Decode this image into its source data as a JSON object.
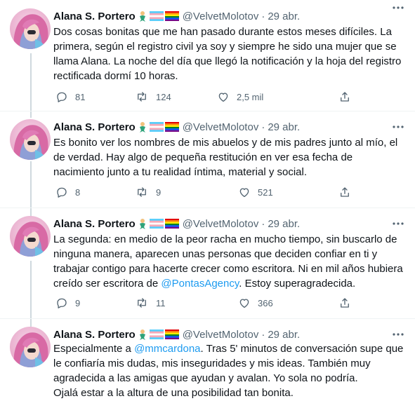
{
  "author": {
    "name": "Alana S. Portero",
    "handle": "@VelvetMolotov",
    "separator": "·",
    "date": "29 abr.",
    "emojis": [
      "mermaid-emoji",
      "trans-flag-emoji",
      "rainbow-flag-emoji"
    ]
  },
  "tweets": [
    {
      "text": "Dos cosas bonitas que me han pasado durante estos meses difíciles. La primera, según el registro civil ya soy y siempre he sido una mujer que se llama Alana. La noche del día que llegó la notificación y la hoja del registro rectificada dormí 10 horas.",
      "replies": "81",
      "retweets": "124",
      "likes": "2,5 mil"
    },
    {
      "text": "Es bonito ver los nombres de mis abuelos y de mis padres junto al mío, el de verdad. Hay algo de pequeña restitución en ver esa fecha de nacimiento junto a tu realidad íntima, material y social.",
      "replies": "8",
      "retweets": "9",
      "likes": "521"
    },
    {
      "text_before": "La segunda: en medio de la peor racha en mucho tiempo, sin buscarlo de ninguna manera, aparecen unas personas que deciden confiar en ti y trabajar contigo para hacerte crecer como escritora. Ni en mil años hubiera creído ser escritora de ",
      "mention": "@PontasAgency",
      "text_after": ". Estoy superagradecida.",
      "replies": "9",
      "retweets": "11",
      "likes": "366"
    },
    {
      "text_before": "Especialmente a ",
      "mention": "@mmcardona",
      "text_after": ". Tras 5' minutos de conversación supe que le confiaría mis dudas, mis inseguridades y mis ideas. También muy agradecida a las amigas que ayudan y avalan. Yo sola no podría.\nOjalá estar a la altura de una posibilidad tan bonita."
    }
  ],
  "colors": {
    "text": "#0f1419",
    "secondary": "#536471",
    "link": "#1d9bf0",
    "thread_line": "#cfd9de",
    "divider": "#eff3f4"
  }
}
